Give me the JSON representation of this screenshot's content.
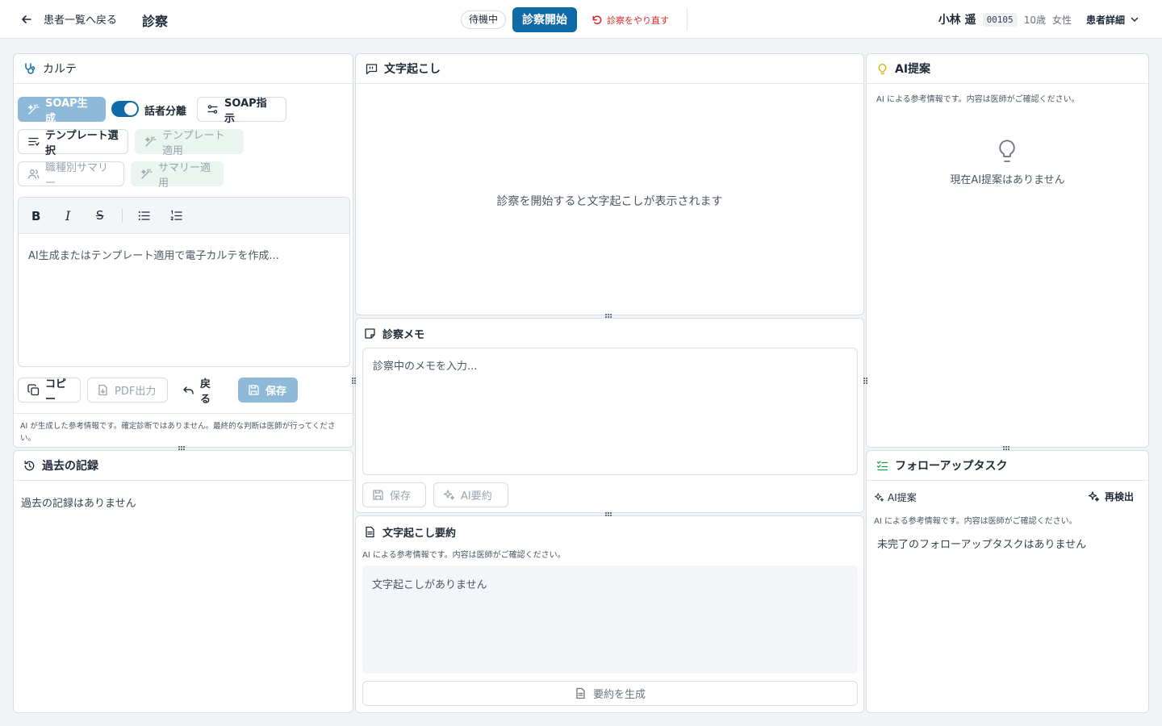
{
  "header": {
    "back_label": "患者一覧へ戻る",
    "title": "診察",
    "status": "待機中",
    "start_label": "診察開始",
    "redo_label": "診察をやり直す",
    "patient_name": "小林 遥",
    "patient_id": "00105",
    "patient_age": "10歳",
    "patient_sex": "女性",
    "detail_label": "患者詳細"
  },
  "karte": {
    "title": "カルテ",
    "soap_generate": "SOAP生成",
    "speaker_toggle": "話者分離",
    "soap_instruction": "SOAP指示",
    "template_select": "テンプレート選択",
    "template_apply": "テンプレート適用",
    "role_summary": "職種別サマリー",
    "summary_apply": "サマリー適用",
    "editor_placeholder": "AI生成またはテンプレート適用で電子カルテを作成...",
    "copy": "コピー",
    "pdf": "PDF出力",
    "undo": "戻る",
    "save": "保存",
    "disclaimer": "AI が生成した参考情報です。確定診断ではありません。最終的な判断は医師が行ってください。"
  },
  "history": {
    "title": "過去の記録",
    "empty": "過去の記録はありません"
  },
  "transcript": {
    "title": "文字起こし",
    "empty": "診察を開始すると文字起こしが表示されます"
  },
  "memo": {
    "title": "診察メモ",
    "placeholder": "診察中のメモを入力...",
    "save": "保存",
    "ai_summary": "AI要約"
  },
  "summary": {
    "title": "文字起こし要約",
    "note": "AI による参考情報です。内容は医師がご確認ください。",
    "empty": "文字起こしがありません",
    "generate": "要約を生成"
  },
  "ai": {
    "title": "AI提案",
    "note": "AI による参考情報です。内容は医師がご確認ください。",
    "empty": "現在AI提案はありません"
  },
  "followup": {
    "title": "フォローアップタスク",
    "ai_label": "AI提案",
    "redetect": "再検出",
    "note": "AI による参考情報です。内容は医師がご確認ください。",
    "empty": "未完了のフォローアップタスクはありません"
  }
}
